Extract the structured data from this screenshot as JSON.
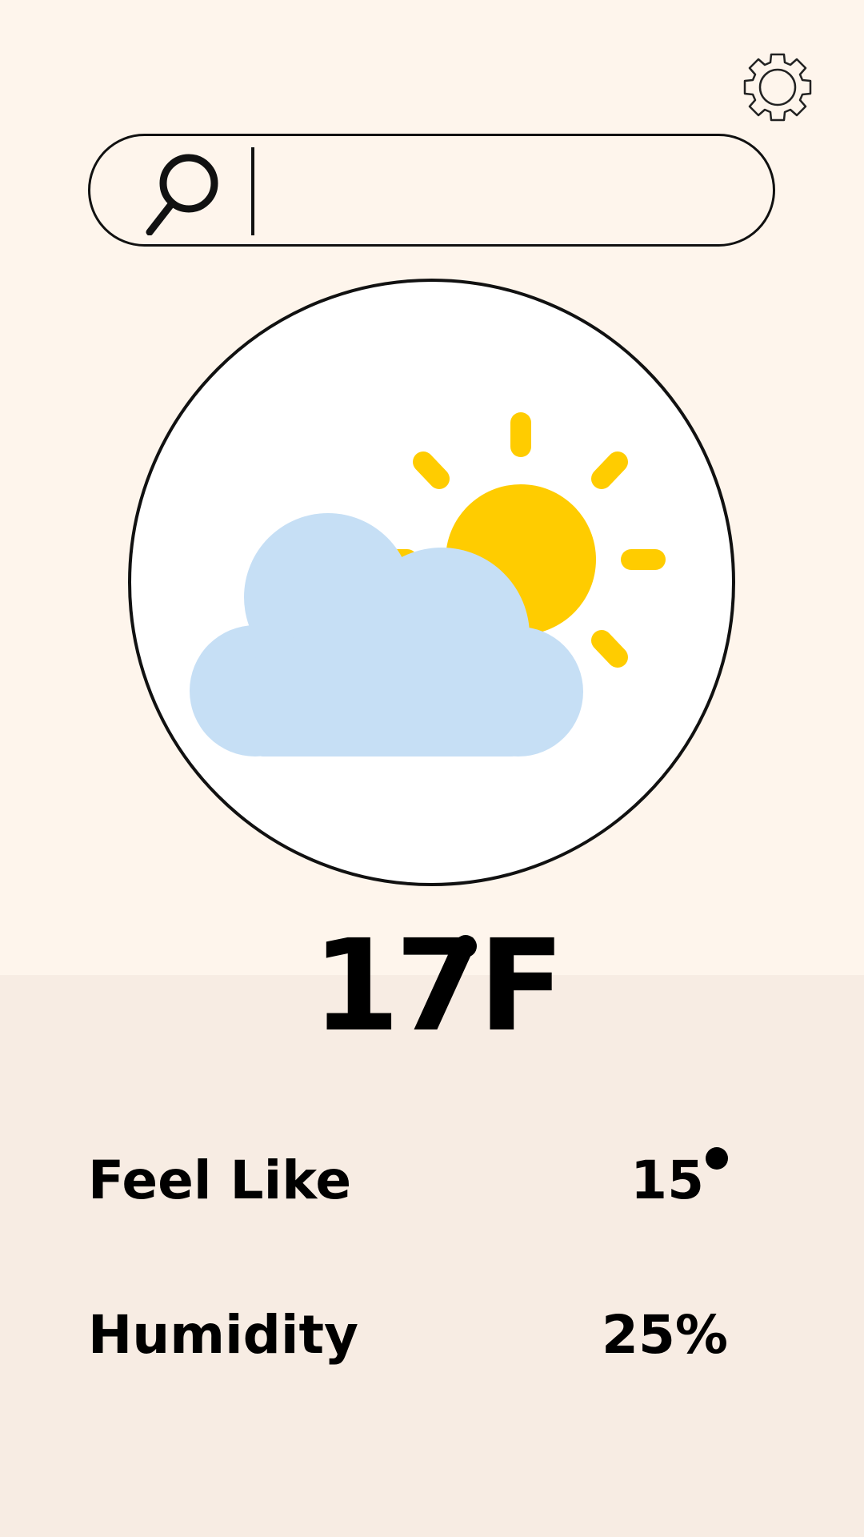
{
  "colors": {
    "background_top": "#FEF5EC",
    "background_bottom": "#F7ECE3",
    "sun": "#FFCC00",
    "cloud": "#C6DFF5",
    "outline": "#111111"
  },
  "header": {
    "settings_icon": "gear-icon"
  },
  "search": {
    "icon": "search-icon",
    "value": "",
    "placeholder": ""
  },
  "weather": {
    "condition_icon": "partly-cloudy-icon",
    "temperature": "17",
    "unit": "F"
  },
  "stats": [
    {
      "label": "Feel Like",
      "value": "15"
    },
    {
      "label": "Humidity",
      "value": "25%"
    }
  ]
}
